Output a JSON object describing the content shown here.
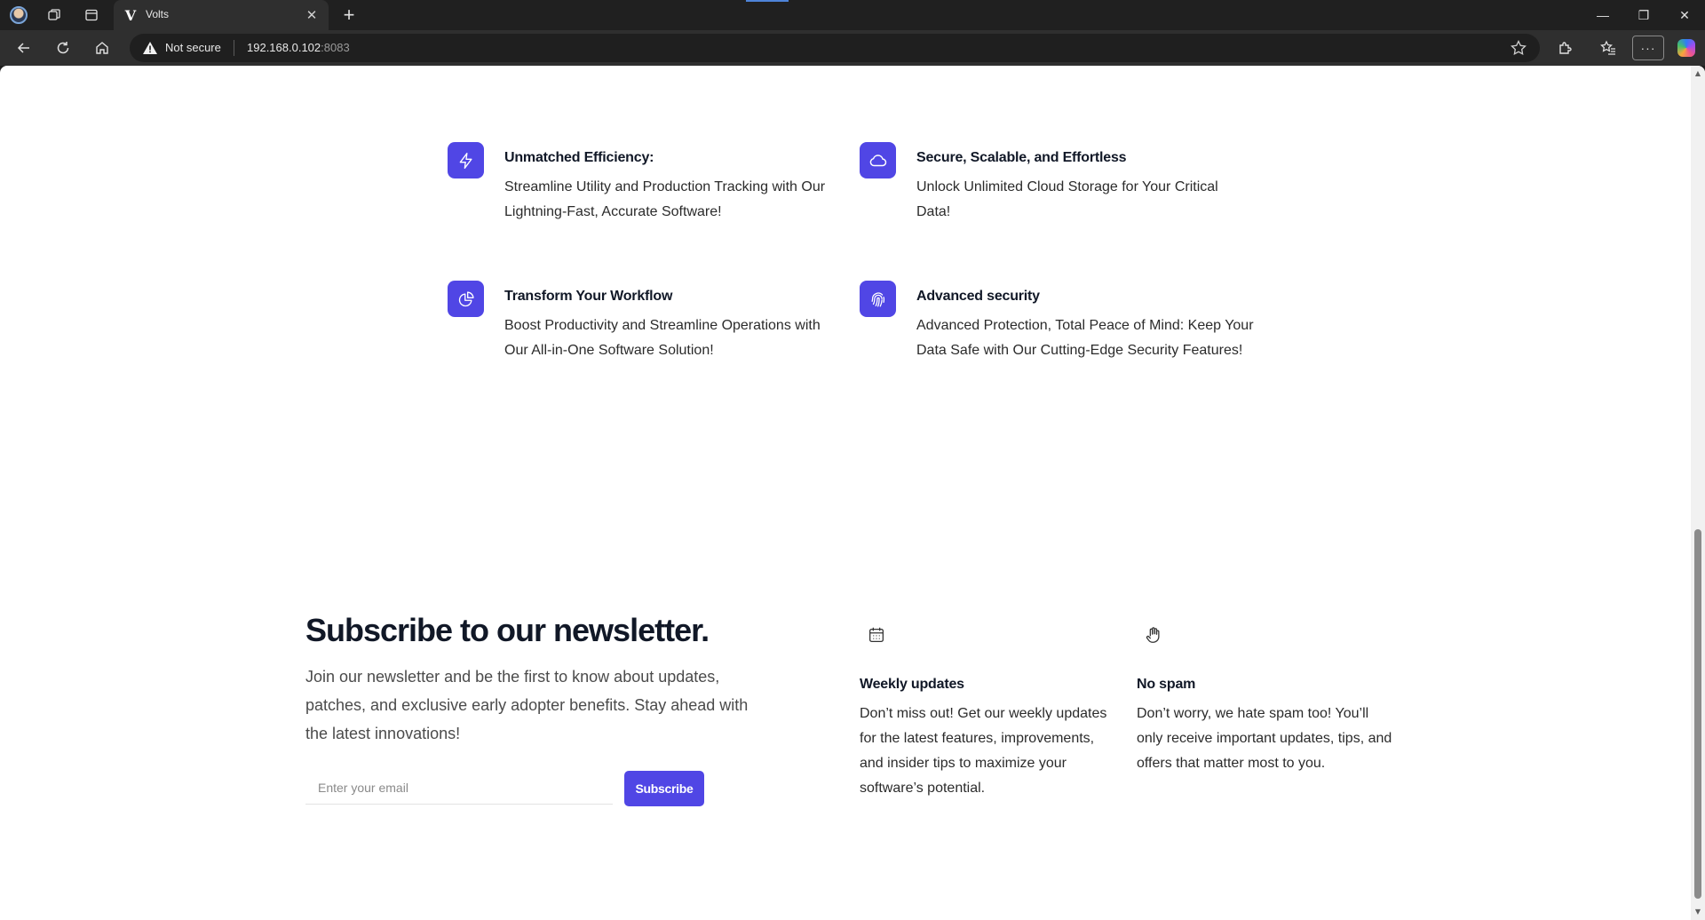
{
  "browser": {
    "tab_title": "Volts",
    "tab_close": "✕",
    "new_tab": "+",
    "security_label": "Not secure",
    "url_host": "192.168.0.102",
    "url_port": ":8083",
    "more_label": "···",
    "window_controls": {
      "minimize": "—",
      "maximize": "❐",
      "close": "✕"
    }
  },
  "features": [
    {
      "icon": "lightning-icon",
      "title": "Unmatched Efficiency:",
      "description": "Streamline Utility and Production Tracking with Our Lightning-Fast, Accurate Software!"
    },
    {
      "icon": "cloud-icon",
      "title": "Secure, Scalable, and Effortless",
      "description": "Unlock Unlimited Cloud Storage for Your Critical Data!"
    },
    {
      "icon": "pie-chart-icon",
      "title": "Transform Your Workflow",
      "description": "Boost Productivity and Streamline Operations with Our All-in-One Software Solution!"
    },
    {
      "icon": "fingerprint-icon",
      "title": "Advanced security",
      "description": "Advanced Protection, Total Peace of Mind: Keep Your Data Safe with Our Cutting-Edge Security Features!"
    }
  ],
  "newsletter": {
    "heading": "Subscribe to our newsletter.",
    "description": "Join our newsletter and be the first to know about updates, patches, and exclusive early adopter benefits. Stay ahead with the latest innovations!",
    "email_placeholder": "Enter your email",
    "email_value": "",
    "subscribe_label": "Subscribe",
    "points": [
      {
        "icon": "calendar-icon",
        "title": "Weekly updates",
        "description": "Don’t miss out! Get our weekly updates for the latest features, improvements, and insider tips to maximize your software’s potential."
      },
      {
        "icon": "hand-icon",
        "title": "No spam",
        "description": "Don’t worry, we hate spam too! You’ll only receive important updates, tips, and offers that matter most to you."
      }
    ]
  },
  "colors": {
    "accent": "#5046e5",
    "heading": "#111827",
    "body_text": "#2b2b2b",
    "chrome_dark": "#202020"
  }
}
